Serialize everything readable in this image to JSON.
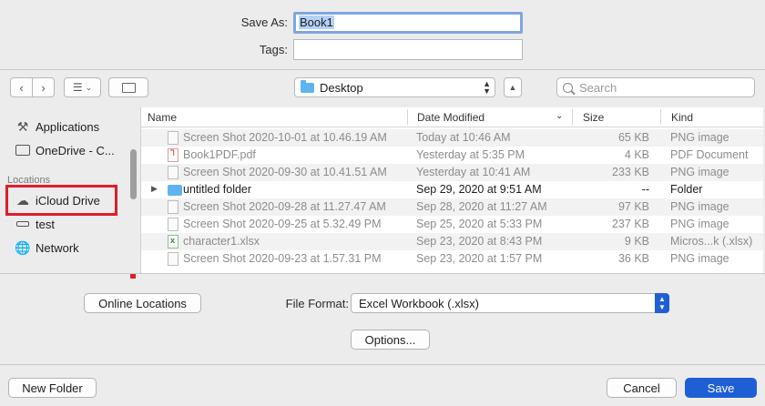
{
  "form": {
    "save_as_label": "Save As:",
    "save_as_value": "Book1",
    "tags_label": "Tags:",
    "tags_value": ""
  },
  "toolbar": {
    "back_icon": "chevron-left-icon",
    "forward_icon": "chevron-right-icon",
    "view_icon": "list-view-icon",
    "new_folder_icon": "new-folder-icon",
    "location": "Desktop",
    "search_placeholder": "Search"
  },
  "sidebar": {
    "items_top": [
      {
        "label": "Applications",
        "icon": "applications-icon"
      },
      {
        "label": "OneDrive - C...",
        "icon": "folder-icon"
      }
    ],
    "locations_heading": "Locations",
    "locations": [
      {
        "label": "iCloud Drive",
        "icon": "cloud-icon"
      },
      {
        "label": "test",
        "icon": "drive-icon"
      },
      {
        "label": "Network",
        "icon": "network-icon"
      }
    ]
  },
  "columns": {
    "name": "Name",
    "date": "Date Modified",
    "size": "Size",
    "kind": "Kind"
  },
  "files": [
    {
      "name": "Screen Shot 2020-10-01 at 10.46.19 AM",
      "date": "Today at 10:46 AM",
      "size": "65 KB",
      "kind": "PNG image",
      "type": "png",
      "enabled": false
    },
    {
      "name": "Book1PDF.pdf",
      "date": "Yesterday at 5:35 PM",
      "size": "4 KB",
      "kind": "PDF Document",
      "type": "pdf",
      "enabled": false
    },
    {
      "name": "Screen Shot 2020-09-30 at 10.41.51 AM",
      "date": "Yesterday at 10:41 AM",
      "size": "233 KB",
      "kind": "PNG image",
      "type": "png",
      "enabled": false
    },
    {
      "name": "untitled folder",
      "date": "Sep 29, 2020 at 9:51 AM",
      "size": "--",
      "kind": "Folder",
      "type": "folder",
      "enabled": true
    },
    {
      "name": "Screen Shot 2020-09-28 at 11.27.47 AM",
      "date": "Sep 28, 2020 at 11:27 AM",
      "size": "97 KB",
      "kind": "PNG image",
      "type": "png",
      "enabled": false
    },
    {
      "name": "Screen Shot 2020-09-25 at 5.32.49 PM",
      "date": "Sep 25, 2020 at 5:33 PM",
      "size": "237 KB",
      "kind": "PNG image",
      "type": "png",
      "enabled": false
    },
    {
      "name": "character1.xlsx",
      "date": "Sep 23, 2020 at 8:43 PM",
      "size": "9 KB",
      "kind": "Micros...k (.xlsx)",
      "type": "xlsx",
      "enabled": false
    },
    {
      "name": "Screen Shot 2020-09-23 at 1.57.31 PM",
      "date": "Sep 23, 2020 at 1:57 PM",
      "size": "36 KB",
      "kind": "PNG image",
      "type": "png",
      "enabled": false
    }
  ],
  "options": {
    "online_locations": "Online Locations",
    "file_format_label": "File Format:",
    "file_format_value": "Excel Workbook (.xlsx)",
    "options_button": "Options..."
  },
  "footer": {
    "new_folder": "New Folder",
    "cancel": "Cancel",
    "save": "Save"
  },
  "colors": {
    "accent": "#1f5fd6",
    "highlight_box": "#dd1e2a",
    "focus_ring": "#7ea6e0"
  }
}
